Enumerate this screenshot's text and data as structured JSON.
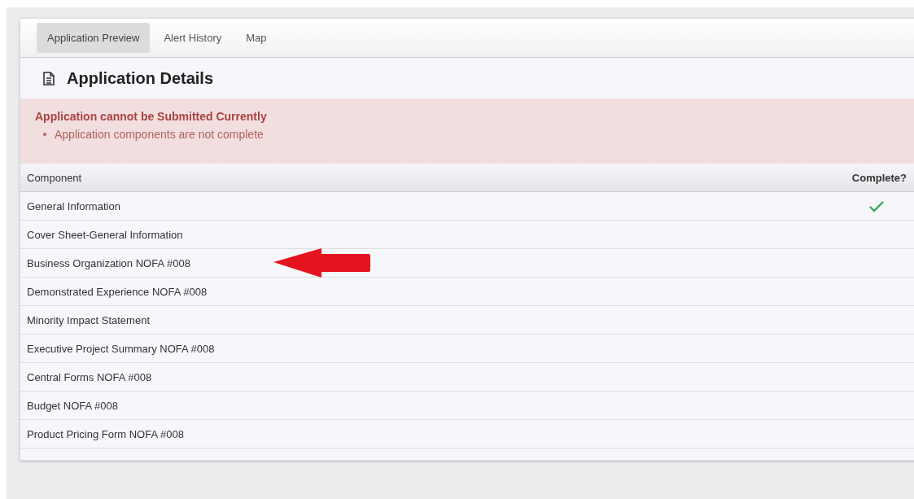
{
  "tabs": [
    {
      "label": "Application Preview",
      "selected": true
    },
    {
      "label": "Alert History",
      "selected": false
    },
    {
      "label": "Map",
      "selected": false
    }
  ],
  "heading": "Application Details",
  "alert": {
    "title": "Application cannot be Submitted Currently",
    "items": [
      "Application components are not complete"
    ]
  },
  "table": {
    "columns": [
      "Component",
      "Complete?"
    ],
    "rows": [
      {
        "component": "General Information",
        "complete": true
      },
      {
        "component": "Cover Sheet-General Information",
        "complete": false
      },
      {
        "component": "Business Organization NOFA #008",
        "complete": false,
        "highlighted": true
      },
      {
        "component": "Demonstrated Experience NOFA #008",
        "complete": false
      },
      {
        "component": "Minority Impact Statement",
        "complete": false
      },
      {
        "component": "Executive Project Summary NOFA #008",
        "complete": false
      },
      {
        "component": "Central Forms NOFA #008",
        "complete": false
      },
      {
        "component": "Budget NOFA #008",
        "complete": false
      },
      {
        "component": "Product Pricing Form NOFA #008",
        "complete": false
      }
    ]
  }
}
